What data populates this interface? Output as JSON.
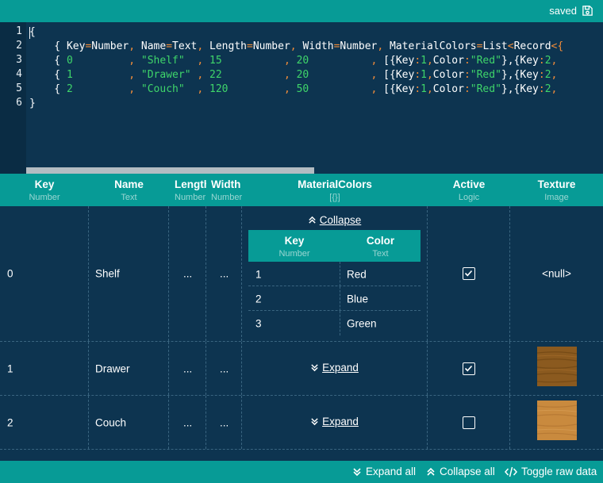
{
  "status": {
    "label": "saved",
    "icon": "save-icon"
  },
  "editor": {
    "line_numbers": [
      "1",
      "2",
      "3",
      "4",
      "5",
      "6"
    ],
    "lines": [
      [
        {
          "t": "{",
          "c": "p"
        }
      ],
      [
        {
          "t": "    { ",
          "c": "p"
        },
        {
          "t": "Key",
          "c": "p"
        },
        {
          "t": "=",
          "c": "o"
        },
        {
          "t": "Number",
          "c": "p"
        },
        {
          "t": ", ",
          "c": "o"
        },
        {
          "t": "Name",
          "c": "p"
        },
        {
          "t": "=",
          "c": "o"
        },
        {
          "t": "Text",
          "c": "p"
        },
        {
          "t": ", ",
          "c": "o"
        },
        {
          "t": "Length",
          "c": "p"
        },
        {
          "t": "=",
          "c": "o"
        },
        {
          "t": "Number",
          "c": "p"
        },
        {
          "t": ", ",
          "c": "o"
        },
        {
          "t": "Width",
          "c": "p"
        },
        {
          "t": "=",
          "c": "o"
        },
        {
          "t": "Number",
          "c": "p"
        },
        {
          "t": ", ",
          "c": "o"
        },
        {
          "t": "MaterialColors",
          "c": "p"
        },
        {
          "t": "=",
          "c": "o"
        },
        {
          "t": "List",
          "c": "p"
        },
        {
          "t": "<",
          "c": "o"
        },
        {
          "t": "Record",
          "c": "p"
        },
        {
          "t": "<{",
          "c": "o"
        }
      ],
      [
        {
          "t": "    { ",
          "c": "p"
        },
        {
          "t": "0         ",
          "c": "g"
        },
        {
          "t": ", ",
          "c": "o"
        },
        {
          "t": "\"Shelf\"  ",
          "c": "g"
        },
        {
          "t": ", ",
          "c": "o"
        },
        {
          "t": "15          ",
          "c": "g"
        },
        {
          "t": ", ",
          "c": "o"
        },
        {
          "t": "20          ",
          "c": "g"
        },
        {
          "t": ", ",
          "c": "o"
        },
        {
          "t": "[{",
          "c": "p"
        },
        {
          "t": "Key",
          "c": "p"
        },
        {
          "t": ":",
          "c": "o"
        },
        {
          "t": "1",
          "c": "g"
        },
        {
          "t": ",",
          "c": "o"
        },
        {
          "t": "Color",
          "c": "p"
        },
        {
          "t": ":",
          "c": "o"
        },
        {
          "t": "\"Red\"",
          "c": "g"
        },
        {
          "t": "},{",
          "c": "p"
        },
        {
          "t": "Key",
          "c": "p"
        },
        {
          "t": ":",
          "c": "o"
        },
        {
          "t": "2",
          "c": "g"
        },
        {
          "t": ",",
          "c": "o"
        }
      ],
      [
        {
          "t": "    { ",
          "c": "p"
        },
        {
          "t": "1         ",
          "c": "g"
        },
        {
          "t": ", ",
          "c": "o"
        },
        {
          "t": "\"Drawer\" ",
          "c": "g"
        },
        {
          "t": ", ",
          "c": "o"
        },
        {
          "t": "22          ",
          "c": "g"
        },
        {
          "t": ", ",
          "c": "o"
        },
        {
          "t": "20          ",
          "c": "g"
        },
        {
          "t": ", ",
          "c": "o"
        },
        {
          "t": "[{",
          "c": "p"
        },
        {
          "t": "Key",
          "c": "p"
        },
        {
          "t": ":",
          "c": "o"
        },
        {
          "t": "1",
          "c": "g"
        },
        {
          "t": ",",
          "c": "o"
        },
        {
          "t": "Color",
          "c": "p"
        },
        {
          "t": ":",
          "c": "o"
        },
        {
          "t": "\"Red\"",
          "c": "g"
        },
        {
          "t": "},{",
          "c": "p"
        },
        {
          "t": "Key",
          "c": "p"
        },
        {
          "t": ":",
          "c": "o"
        },
        {
          "t": "2",
          "c": "g"
        },
        {
          "t": ",",
          "c": "o"
        }
      ],
      [
        {
          "t": "    { ",
          "c": "p"
        },
        {
          "t": "2         ",
          "c": "g"
        },
        {
          "t": ", ",
          "c": "o"
        },
        {
          "t": "\"Couch\"  ",
          "c": "g"
        },
        {
          "t": ", ",
          "c": "o"
        },
        {
          "t": "120         ",
          "c": "g"
        },
        {
          "t": ", ",
          "c": "o"
        },
        {
          "t": "50          ",
          "c": "g"
        },
        {
          "t": ", ",
          "c": "o"
        },
        {
          "t": "[{",
          "c": "p"
        },
        {
          "t": "Key",
          "c": "p"
        },
        {
          "t": ":",
          "c": "o"
        },
        {
          "t": "1",
          "c": "g"
        },
        {
          "t": ",",
          "c": "o"
        },
        {
          "t": "Color",
          "c": "p"
        },
        {
          "t": ":",
          "c": "o"
        },
        {
          "t": "\"Red\"",
          "c": "g"
        },
        {
          "t": "},{",
          "c": "p"
        },
        {
          "t": "Key",
          "c": "p"
        },
        {
          "t": ":",
          "c": "o"
        },
        {
          "t": "2",
          "c": "g"
        },
        {
          "t": ",",
          "c": "o"
        }
      ],
      [
        {
          "t": "}",
          "c": "p"
        }
      ]
    ]
  },
  "columns": [
    {
      "name": "Key",
      "type": "Number"
    },
    {
      "name": "Name",
      "type": "Text"
    },
    {
      "name": "Length",
      "type": "Number"
    },
    {
      "name": "Width",
      "type": "Number"
    },
    {
      "name": "MaterialColors",
      "type": "[{}]"
    },
    {
      "name": "Active",
      "type": "Logic"
    },
    {
      "name": "Texture",
      "type": "Image"
    }
  ],
  "rows": [
    {
      "key": "0",
      "name": "Shelf",
      "length": "...",
      "width": "...",
      "active": true,
      "texture": "<null>",
      "materials_action": "Collapse",
      "expanded": true
    },
    {
      "key": "1",
      "name": "Drawer",
      "length": "...",
      "width": "...",
      "active": true,
      "texture_color": "#8b5a1f",
      "materials_action": "Expand",
      "expanded": false
    },
    {
      "key": "2",
      "name": "Couch",
      "length": "...",
      "width": "...",
      "active": false,
      "texture_color": "#c98a3e",
      "materials_action": "Expand",
      "expanded": false
    }
  ],
  "nested": {
    "columns": [
      {
        "name": "Key",
        "type": "Number"
      },
      {
        "name": "Color",
        "type": "Text"
      }
    ],
    "rows": [
      {
        "key": "1",
        "color": "Red"
      },
      {
        "key": "2",
        "color": "Blue"
      },
      {
        "key": "3",
        "color": "Green"
      }
    ]
  },
  "footer": {
    "expand_all": "Expand all",
    "collapse_all": "Collapse all",
    "toggle_raw": "Toggle raw data"
  },
  "colors": {
    "teal": "#079b96",
    "navy": "#0d3450",
    "operator": "#f08c3a",
    "literal": "#3fd56a"
  }
}
